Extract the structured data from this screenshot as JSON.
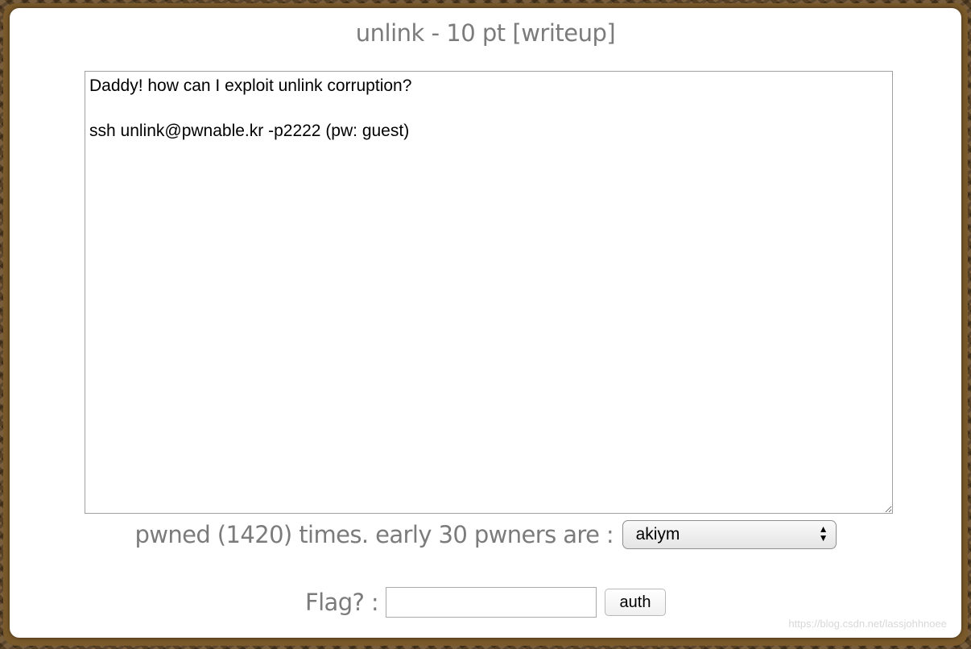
{
  "challenge": {
    "title": "unlink - 10 pt ",
    "writeup_link": "[writeup]",
    "description_lines": [
      "Daddy! how can I exploit unlink corruption?",
      "",
      "ssh unlink@pwnable.kr -p2222 (pw: guest)"
    ],
    "description": "Daddy! how can I exploit unlink corruption?\n\nssh unlink@pwnable.kr -p2222 (pw: guest)"
  },
  "pwned": {
    "text": "pwned (1420) times. early 30 pwners are :",
    "selected_pwner": "akiym",
    "select_arrows": "▲▼"
  },
  "flag": {
    "label": "Flag? :",
    "input_value": "",
    "submit_label": "auth"
  },
  "watermark": "https://blog.csdn.net/lassjohhnoee",
  "colors": {
    "frame": "#7a5a2a",
    "panel": "#ffffff",
    "muted_text": "#7b7b7b"
  }
}
